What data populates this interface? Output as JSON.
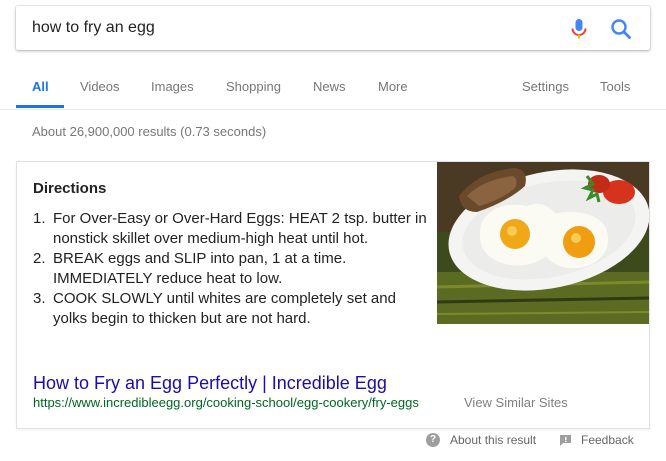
{
  "search": {
    "query": "how to fry an egg"
  },
  "tabs": [
    {
      "label": "All",
      "active": true
    },
    {
      "label": "Videos"
    },
    {
      "label": "Images"
    },
    {
      "label": "Shopping"
    },
    {
      "label": "News"
    },
    {
      "label": "More"
    },
    {
      "label": "Settings"
    },
    {
      "label": "Tools"
    }
  ],
  "stats": "About 26,900,000 results (0.73 seconds)",
  "snippet": {
    "title": "Directions",
    "steps": [
      {
        "num": "1.",
        "text": "For Over-Easy or Over-Hard Eggs: HEAT 2 tsp. butter in nonstick skillet over medium-high heat until hot."
      },
      {
        "num": "2.",
        "text": "BREAK eggs and SLIP into pan, 1 at a time. IMMEDIATELY reduce heat to low."
      },
      {
        "num": "3.",
        "text": "COOK SLOWLY until whites are completely set and yolks begin to thicken but are not hard."
      }
    ],
    "link_title": "How to Fry an Egg Perfectly | Incredible Egg",
    "link_url": "https://www.incredibleegg.org/cooking-school/egg-cookery/fry-eggs",
    "similar": "View Similar Sites"
  },
  "footer": {
    "about": "About this result",
    "feedback": "Feedback"
  },
  "colors": {
    "accent": "#1a73e8",
    "link": "#1a0dab",
    "url": "#006621"
  }
}
